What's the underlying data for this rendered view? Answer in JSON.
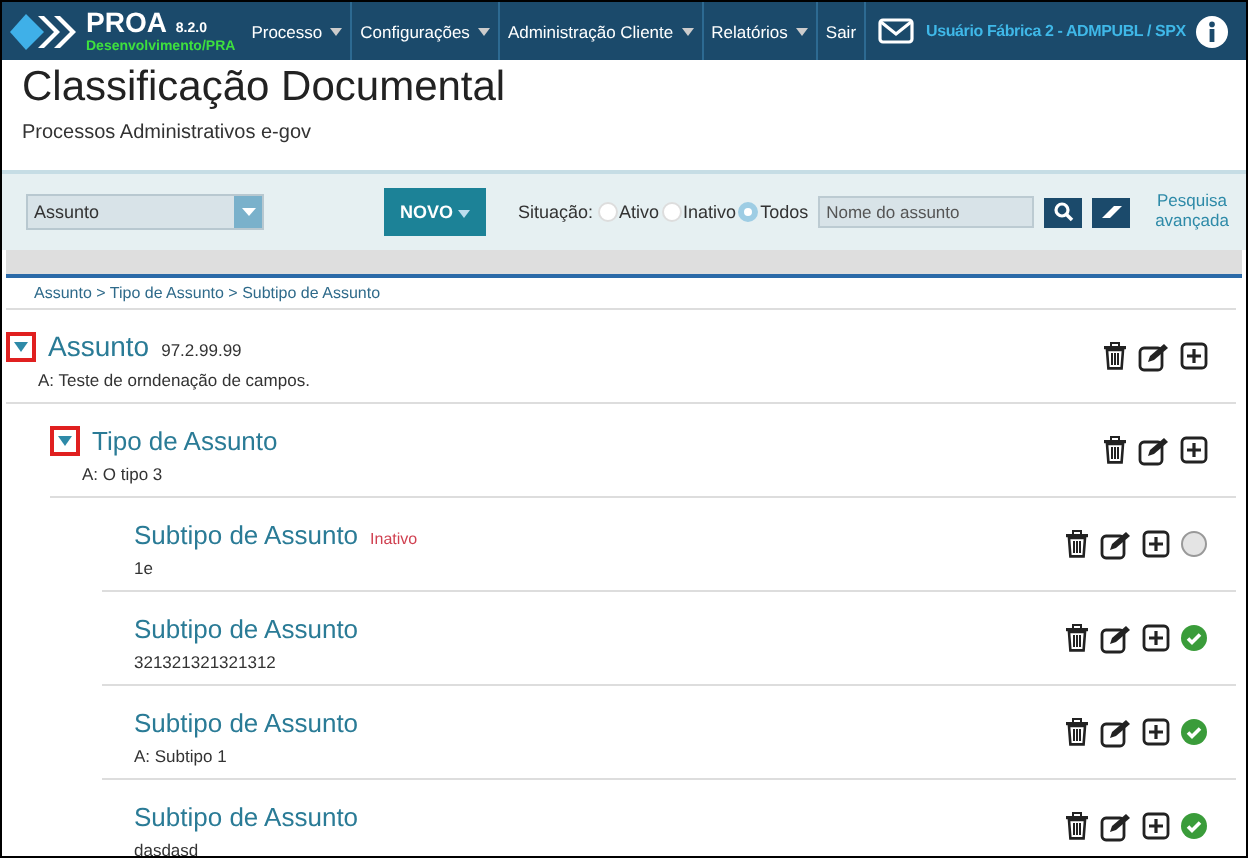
{
  "header": {
    "logo": "PROA",
    "version": "8.2.0",
    "environment": "Desenvolvimento/PRA",
    "menu": [
      {
        "label": "Processo",
        "dropdown": true
      },
      {
        "label": "Configurações",
        "dropdown": true
      },
      {
        "label": "Administração Cliente",
        "dropdown": true
      },
      {
        "label": "Relatórios",
        "dropdown": true
      },
      {
        "label": "Sair",
        "dropdown": false
      }
    ],
    "user": "Usuário Fábrica 2 - ADMPUBL / SPX"
  },
  "page": {
    "title": "Classificação Documental",
    "subtitle": "Processos Administrativos e-gov"
  },
  "toolbar": {
    "type_select": "Assunto",
    "new_button": "NOVO",
    "status_label": "Situação:",
    "status_options": [
      {
        "label": "Ativo",
        "selected": false
      },
      {
        "label": "Inativo",
        "selected": false
      },
      {
        "label": "Todos",
        "selected": true
      }
    ],
    "search": {
      "placeholder": "Nome do assunto"
    },
    "advanced_link": "Pesquisa avançada"
  },
  "breadcrumb": "Assunto > Tipo de Assunto > Subtipo de Assunto",
  "tree": [
    {
      "title": "Assunto",
      "code": "97.2.99.99",
      "description": "A: Teste de orndenação de campos.",
      "expanded": true,
      "children": [
        {
          "title": "Tipo de Assunto",
          "description": "A: O tipo 3",
          "expanded": true,
          "children": [
            {
              "title": "Subtipo de Assunto",
              "badge": "Inativo",
              "description": "1e",
              "active": false
            },
            {
              "title": "Subtipo de Assunto",
              "description": "321321321321312",
              "active": true
            },
            {
              "title": "Subtipo de Assunto",
              "description": "A: Subtipo 1",
              "active": true
            },
            {
              "title": "Subtipo de Assunto",
              "description": "dasdasd",
              "active": true
            }
          ]
        }
      ]
    }
  ]
}
